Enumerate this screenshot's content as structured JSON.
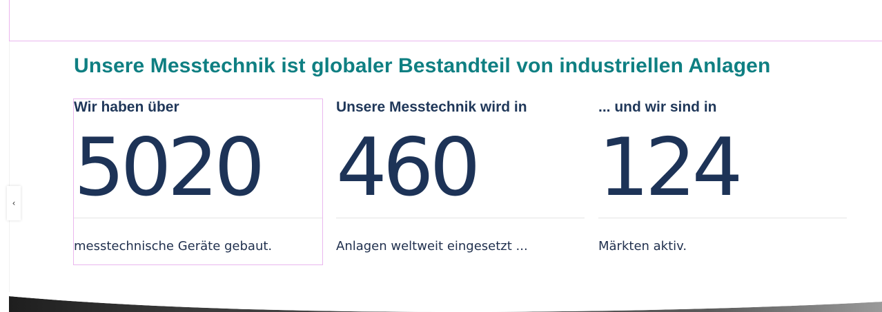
{
  "section": {
    "headline": "Unsere Messtechnik ist globaler Bestandteil von industriellen Anlagen"
  },
  "stats": [
    {
      "intro": "Wir haben über",
      "number": "5020",
      "caption": "messtechnische Geräte gebaut."
    },
    {
      "intro": "Unsere Messtechnik wird in",
      "number": "460",
      "caption": "Anlagen weltweit eingesetzt ..."
    },
    {
      "intro": "... und wir sind in",
      "number": "124",
      "caption": "Märkten aktiv."
    }
  ],
  "nav": {
    "side_toggle": "‹"
  },
  "colors": {
    "headline": "#0f7f82",
    "text_dark": "#1d3357",
    "selection_outline": "#eab6ee"
  }
}
